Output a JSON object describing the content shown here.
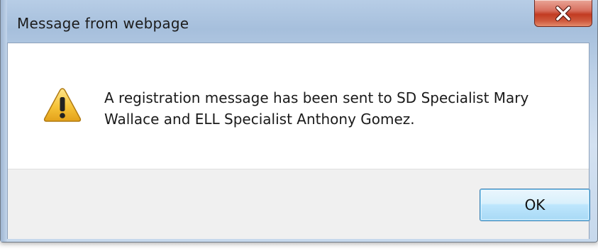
{
  "dialog": {
    "title": "Message from webpage",
    "close_icon": "close-icon",
    "warning_icon": "warning-icon",
    "message_line1": "A registration message has been sent to SD Specialist Mary",
    "message_line2": "Wallace and ELL Specialist Anthony Gomez.",
    "ok_label": "OK"
  },
  "colors": {
    "close_button": "#c23b22",
    "ok_button_border": "#3c7fb1",
    "warning_yellow": "#f6c338"
  }
}
